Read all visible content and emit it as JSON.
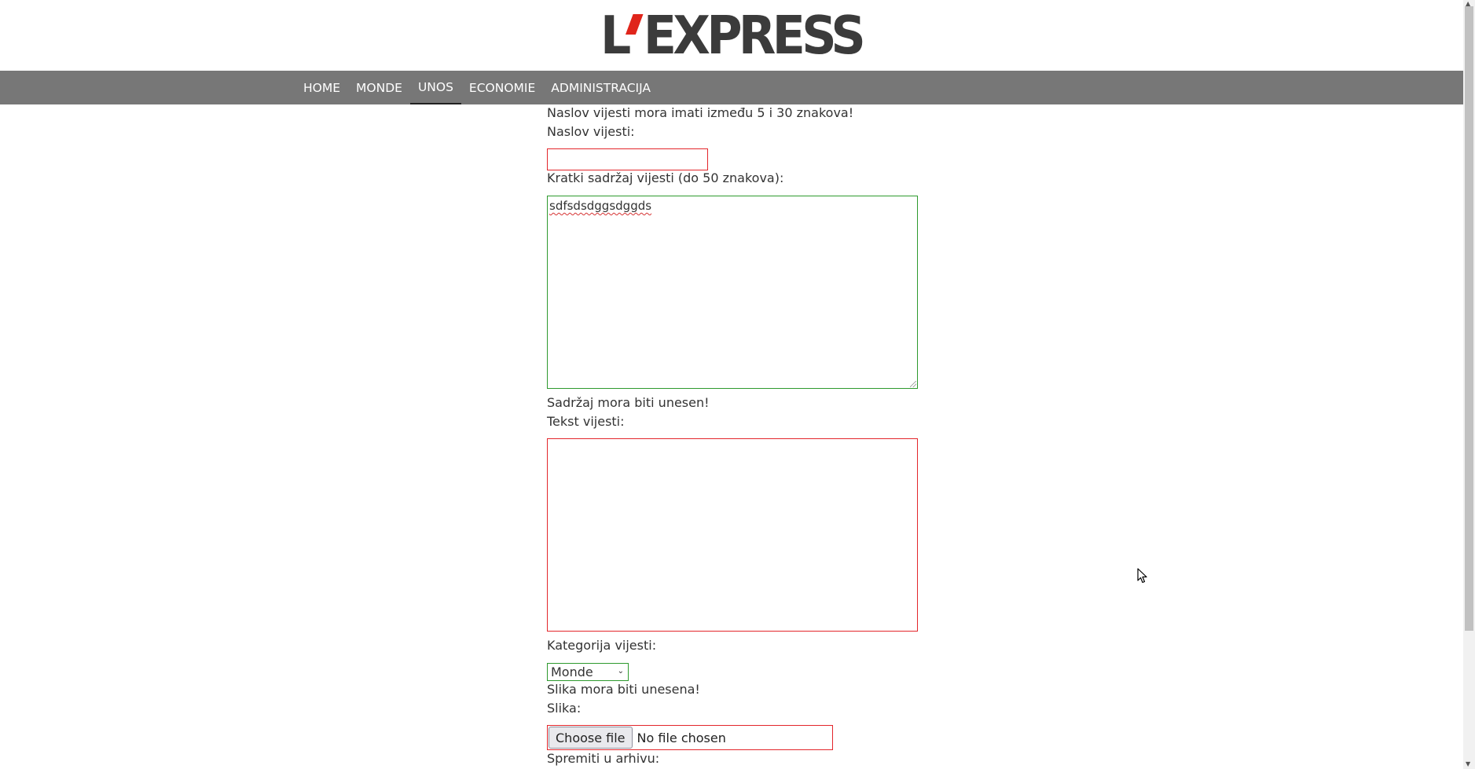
{
  "logo": {
    "text_left": "L",
    "text_right": "EXPRESS"
  },
  "nav": {
    "items": [
      {
        "label": "HOME"
      },
      {
        "label": "MONDE"
      },
      {
        "label": "UNOS"
      },
      {
        "label": "ECONOMIE"
      },
      {
        "label": "ADMINISTRACIJA"
      }
    ],
    "active": "UNOS"
  },
  "form": {
    "title_error": "Naslov vijesti mora imati između 5 i 30 znakova!",
    "title_label": "Naslov vijesti:",
    "title_value": "",
    "summary_label": "Kratki sadržaj vijesti (do 50 znakova):",
    "summary_value": "sdfsdsdggsdggds",
    "content_error": "Sadržaj mora biti unesen!",
    "content_label": "Tekst vijesti:",
    "content_value": "",
    "category_label": "Kategorija vijesti:",
    "category_selected": "Monde",
    "image_error": "Slika mora biti unesena!",
    "image_label": "Slika:",
    "file_button": "Choose file",
    "file_status": "No file chosen",
    "archive_label": "Spremiti u arhivu:"
  },
  "colors": {
    "nav_bg": "#777777",
    "error_border": "#e3262b",
    "valid_border": "#2e9a2e",
    "logo_accent": "#e0251b"
  }
}
